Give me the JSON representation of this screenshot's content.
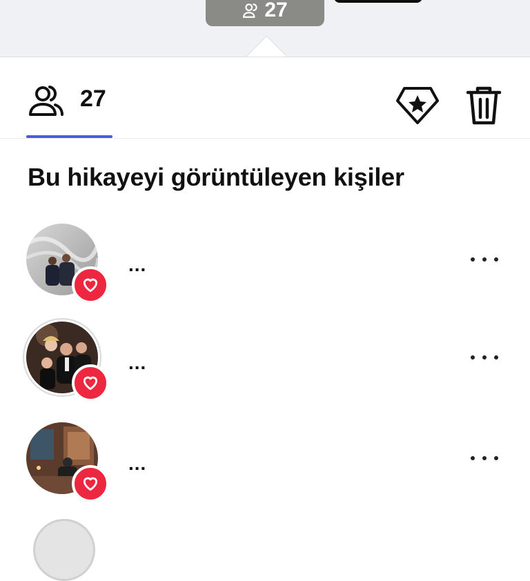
{
  "story_thumb": {
    "views": "27"
  },
  "tabs": {
    "viewers_count": "27"
  },
  "section_title": "Bu hikayeyi görüntüleyen kişiler",
  "viewers": [
    {
      "name": "...",
      "liked": true
    },
    {
      "name": "...",
      "liked": true
    },
    {
      "name": "...",
      "liked": true
    }
  ],
  "colors": {
    "accent": "#4a5bdc",
    "heart": "#ee2740"
  }
}
